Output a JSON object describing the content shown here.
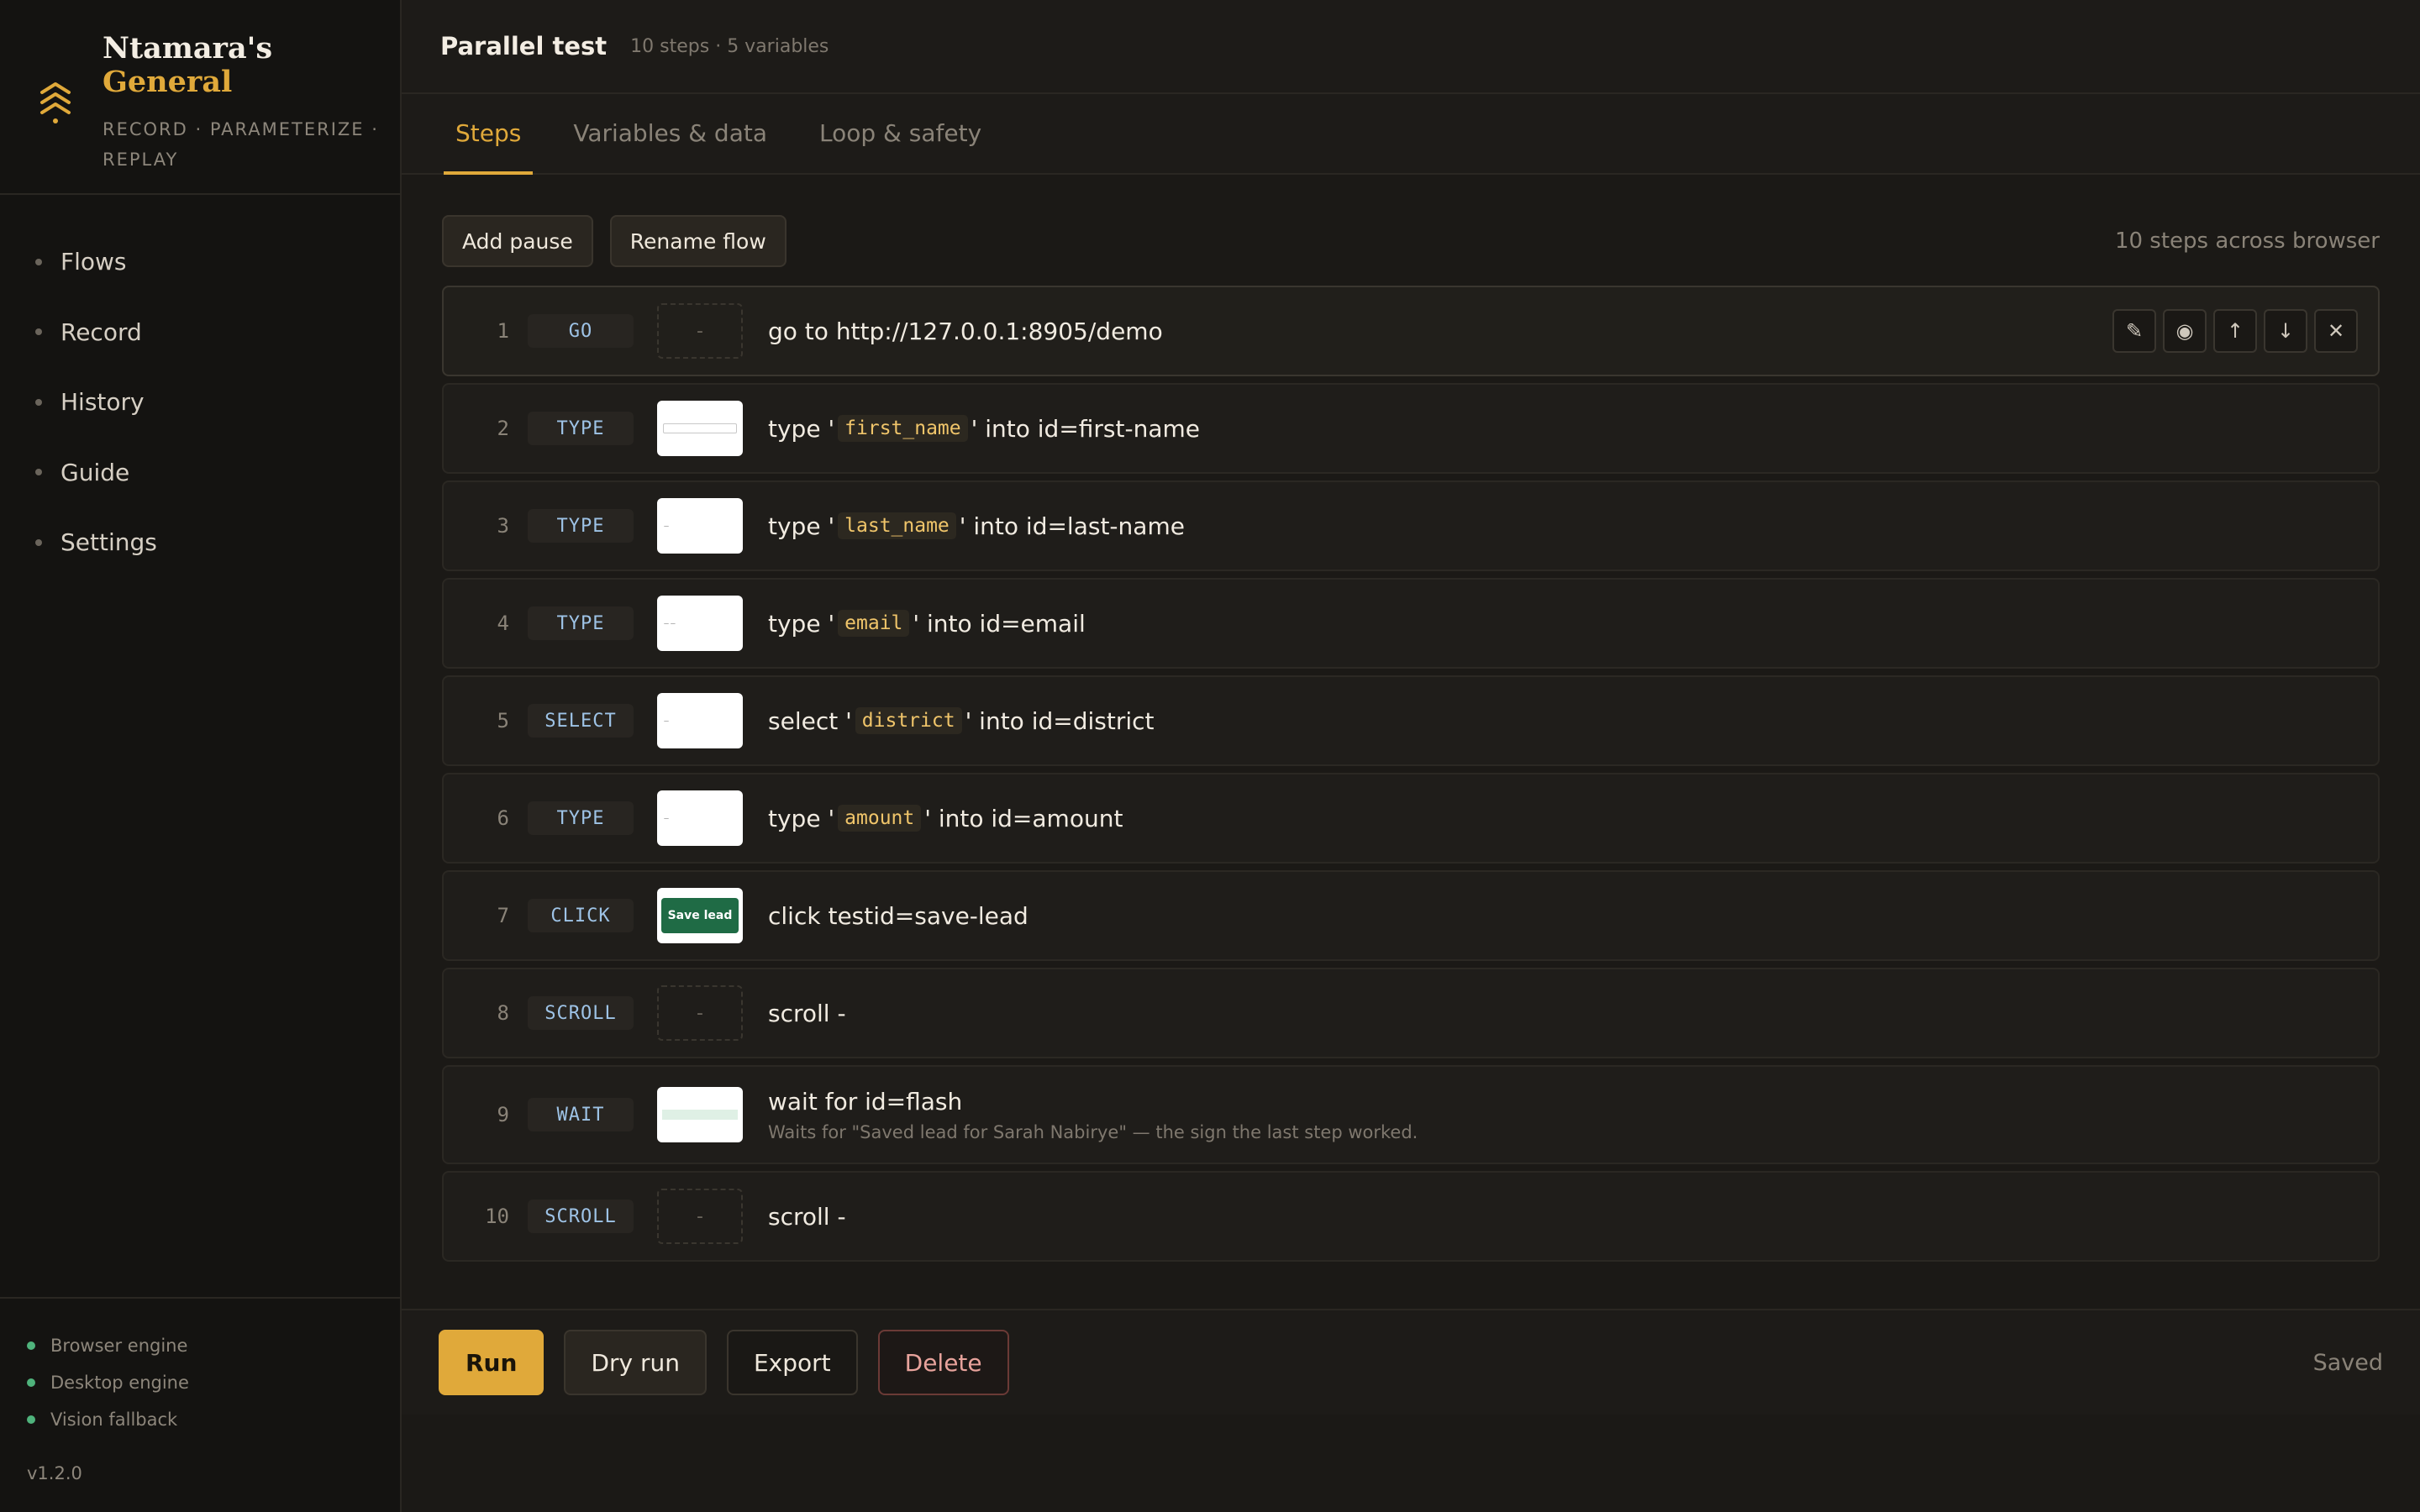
{
  "brand": {
    "title_line1": "Ntamara's",
    "title_line2": "General",
    "tagline": "RECORD · PARAMETERIZE · REPLAY",
    "accent": "#e0a93a"
  },
  "sidebar": {
    "items": [
      {
        "label": "Flows"
      },
      {
        "label": "Record"
      },
      {
        "label": "History"
      },
      {
        "label": "Guide"
      },
      {
        "label": "Settings"
      }
    ],
    "engines": [
      {
        "label": "Browser engine"
      },
      {
        "label": "Desktop engine"
      },
      {
        "label": "Vision fallback"
      }
    ],
    "version": "v1.2.0"
  },
  "header": {
    "title": "Parallel test",
    "meta": "10 steps · 5 variables"
  },
  "tabs": [
    {
      "label": "Steps",
      "active": true
    },
    {
      "label": "Variables & data",
      "active": false
    },
    {
      "label": "Loop & safety",
      "active": false
    }
  ],
  "toolbar": {
    "add_pause": "Add pause",
    "rename_flow": "Rename flow",
    "info": "10 steps across browser"
  },
  "steps": [
    {
      "num": "1",
      "type": "GO",
      "thumb": "-",
      "pre": "go to http://127.0.0.1:8905/demo",
      "var": "",
      "post": ""
    },
    {
      "num": "2",
      "type": "TYPE",
      "pre": "type '",
      "var": "first_name",
      "post": "' into id=first-name"
    },
    {
      "num": "3",
      "type": "TYPE",
      "pre": "type '",
      "var": "last_name",
      "post": "' into id=last-name"
    },
    {
      "num": "4",
      "type": "TYPE",
      "pre": "type '",
      "var": "email",
      "post": "' into id=email"
    },
    {
      "num": "5",
      "type": "SELECT",
      "pre": "select '",
      "var": "district",
      "post": "' into id=district"
    },
    {
      "num": "6",
      "type": "TYPE",
      "pre": "type '",
      "var": "amount",
      "post": "' into id=amount"
    },
    {
      "num": "7",
      "type": "CLICK",
      "thumb_button": "Save lead",
      "pre": "click testid=save-lead",
      "var": "",
      "post": ""
    },
    {
      "num": "8",
      "type": "SCROLL",
      "thumb": "-",
      "pre": "scroll -",
      "var": "",
      "post": ""
    },
    {
      "num": "9",
      "type": "WAIT",
      "pre": "wait for id=flash",
      "var": "",
      "post": "",
      "sub": "Waits for \"Saved lead for Sarah Nabirye\" — the sign the last step worked."
    },
    {
      "num": "10",
      "type": "SCROLL",
      "thumb": "-",
      "pre": "scroll -",
      "var": "",
      "post": ""
    }
  ],
  "step_actions": {
    "edit_icon": "✎",
    "record_icon": "◉",
    "up_icon": "↑",
    "down_icon": "↓",
    "close_icon": "✕"
  },
  "bottom": {
    "run": "Run",
    "dry_run": "Dry run",
    "export": "Export",
    "delete": "Delete",
    "status": "Saved"
  }
}
